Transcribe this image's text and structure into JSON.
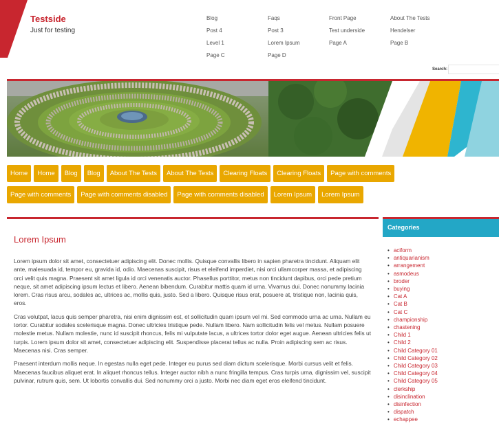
{
  "site": {
    "title": "Testside",
    "tagline": "Just for testing",
    "brand_red": "#c8262f",
    "menu_yellow": "#e9a700",
    "sidebar_teal": "#23a7c6"
  },
  "top_nav": [
    "Blog",
    "Faqs",
    "Front Page",
    "About The Tests",
    "Post 4",
    "Post 3",
    "Test underside",
    "Hendelser",
    "Level 1",
    "Lorem Ipsum",
    "Page A",
    "Page B",
    "Page C",
    "Page D"
  ],
  "search": {
    "label": "Search:",
    "value": ""
  },
  "menu_rows": [
    [
      "Home",
      "Home",
      "Blog",
      "Blog",
      "About The Tests",
      "About The Tests",
      "Clearing Floats",
      "Clearing Floats",
      "Page with comments"
    ],
    [
      "Page with comments",
      "Page with comments disabled",
      "Page with comments disabled",
      "Lorem Ipsum",
      "Lorem Ipsum"
    ]
  ],
  "post": {
    "title": "Lorem Ipsum",
    "paragraphs": [
      "Lorem ipsum dolor sit amet, consectetuer adipiscing elit. Donec mollis. Quisque convallis libero in sapien pharetra tincidunt. Aliquam elit ante, malesuada id, tempor eu, gravida id, odio. Maecenas suscipit, risus et eleifend imperdiet, nisi orci ullamcorper massa, et adipiscing orci velit quis magna. Praesent sit amet ligula id orci venenatis auctor. Phasellus porttitor, metus non tincidunt dapibus, orci pede pretium neque, sit amet adipiscing ipsum lectus et libero. Aenean bibendum. Curabitur mattis quam id urna. Vivamus dui. Donec nonummy lacinia lorem. Cras risus arcu, sodales ac, ultrices ac, mollis quis, justo. Sed a libero. Quisque risus erat, posuere at, tristique non, lacinia quis, eros.",
      "Cras volutpat, lacus quis semper pharetra, nisi enim dignissim est, et sollicitudin quam ipsum vel mi. Sed commodo urna ac urna. Nullam eu tortor. Curabitur sodales scelerisque magna. Donec ultricies tristique pede. Nullam libero. Nam sollicitudin felis vel metus. Nullam posuere molestie metus. Nullam molestie, nunc id suscipit rhoncus, felis mi vulputate lacus, a ultrices tortor dolor eget augue. Aenean ultricies felis ut turpis. Lorem ipsum dolor sit amet, consectetuer adipiscing elit. Suspendisse placerat tellus ac nulla. Proin adipiscing sem ac risus. Maecenas nisi. Cras semper.",
      "Praesent interdum mollis neque. In egestas nulla eget pede. Integer eu purus sed diam dictum scelerisque. Morbi cursus velit et felis. Maecenas faucibus aliquet erat. In aliquet rhoncus tellus. Integer auctor nibh a nunc fringilla tempus. Cras turpis urna, dignissim vel, suscipit pulvinar, rutrum quis, sem. Ut lobortis convallis dui. Sed nonummy orci a justo. Morbi nec diam eget eros eleifend tincidunt."
    ]
  },
  "sidebar": {
    "heading": "Categories",
    "categories": [
      "aciform",
      "antiquarianism",
      "arrangement",
      "asmodeus",
      "broder",
      "buying",
      "Cat A",
      "Cat B",
      "Cat C",
      "championship",
      "chastening",
      "Child 1",
      "Child 2",
      "Child Category 01",
      "Child Category 02",
      "Child Category 03",
      "Child Category 04",
      "Child Category 05",
      "clerkship",
      "disinclination",
      "disinfection",
      "dispatch",
      "echappee"
    ]
  }
}
